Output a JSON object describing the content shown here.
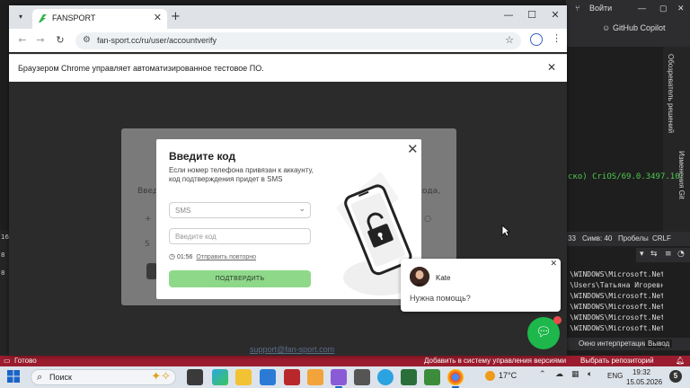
{
  "browser": {
    "tab_title": "FANSPORT",
    "url": "fan-sport.cc/ru/user/accountverify",
    "infobar_text": "Браузером Chrome управляет автоматизированное тестовое ПО."
  },
  "page": {
    "bg_text_left": "Введ",
    "bg_text_right": "кода,",
    "support_email": "support@fan-sport.com"
  },
  "modal": {
    "title": "Введите код",
    "description": "Если номер телефона привязан к аккаунту, код подтверждения придет в SMS",
    "method_select_value": "SMS",
    "code_placeholder": "Введите код",
    "timer": "01:56",
    "resend_label": "Отправить повторно",
    "submit_label": "ПОДТВЕРДИТЬ"
  },
  "chat_widget": {
    "agent_name": "Kate",
    "question": "Нужна помощь?"
  },
  "ide": {
    "sign_in": "Войти",
    "copilot": "GitHub Copilot",
    "side_tab_1": "Обозреватель решений",
    "side_tab_2": "Изменения Git",
    "code_line": "ско) CriOS/69.0.3497.10",
    "status_line": "33",
    "status_chars": "Симв: 40",
    "status_spaces": "Пробелы",
    "status_crlf": "CRLF",
    "output_lines": [
      "\\WINDOWS\\Microsoft.Net\\ass",
      "\\Users\\Татьяна Игоревна\\Do",
      "\\WINDOWS\\Microsoft.Net\\ass",
      "\\WINDOWS\\Microsoft.Net\\ass",
      "\\WINDOWS\\Microsoft.Net\\ass",
      "\\WINDOWS\\Microsoft.Net\\ass"
    ],
    "bottom_tab_1": "Окно интерпретации",
    "bottom_tab_2": "Вывод",
    "statusbar_ready": "Готово",
    "statusbar_scm": "Добавить в систему управления версиями",
    "statusbar_repo": "Выбрать репозиторий",
    "left_strip": [
      "16",
      "8",
      "8"
    ]
  },
  "taskbar": {
    "search_label": "Поиск",
    "weather_temp": "17°C",
    "language": "ENG",
    "time": "19:32",
    "date": "15.05.2026",
    "notifications": "5"
  },
  "colors": {
    "ide_statusbar": "#9b1c2e",
    "submit_button": "#8ed88a",
    "chat_button": "#1db74b"
  }
}
